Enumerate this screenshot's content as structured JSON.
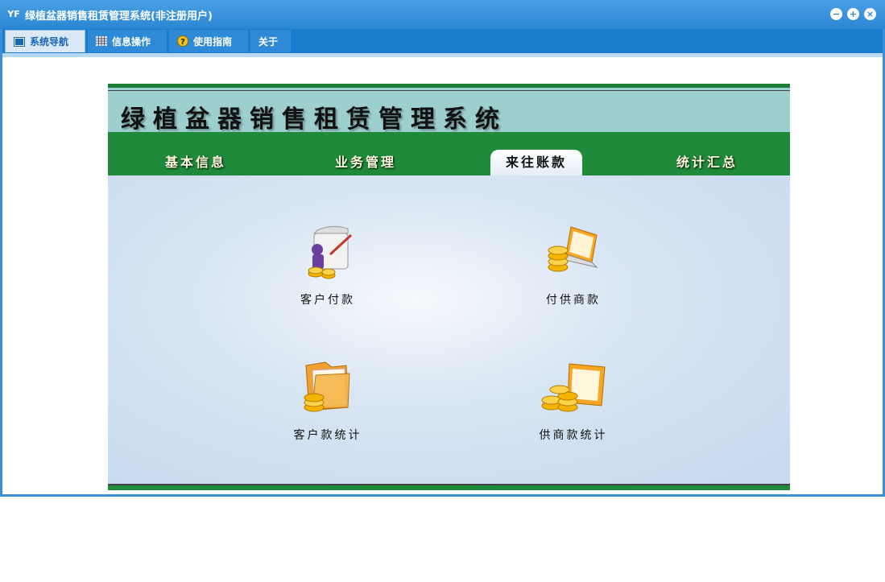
{
  "window": {
    "title": "绿植盆器销售租赁管理系统(非注册用户)",
    "app_icon": "YF",
    "controls": [
      "minimize-icon",
      "maximize-icon",
      "close-icon"
    ]
  },
  "menu": [
    {
      "label": "系统导航",
      "icon": "navigation-icon",
      "active": true
    },
    {
      "label": "信息操作",
      "icon": "grid-icon",
      "active": false
    },
    {
      "label": "使用指南",
      "icon": "help-icon",
      "active": false
    },
    {
      "label": "关于",
      "icon": "",
      "active": false
    }
  ],
  "banner": {
    "title": "绿植盆器销售租赁管理系统"
  },
  "tabs": [
    {
      "label": "基本信息",
      "active": false
    },
    {
      "label": "业务管理",
      "active": false
    },
    {
      "label": "来往账款",
      "active": true
    },
    {
      "label": "统计汇总",
      "active": false
    }
  ],
  "functions": [
    {
      "label": "客户付款",
      "icon": "customer-payment-icon"
    },
    {
      "label": "付供商款",
      "icon": "supplier-payment-icon"
    },
    {
      "label": "客户款统计",
      "icon": "customer-statistics-icon"
    },
    {
      "label": "供商款统计",
      "icon": "supplier-statistics-icon"
    }
  ],
  "colors": {
    "titlebar": "#2b86d2",
    "menubar": "#1a7ccc",
    "banner": "#9ecfcf",
    "tabbar": "#1f8a3a",
    "panel": "#c6d9ee"
  }
}
